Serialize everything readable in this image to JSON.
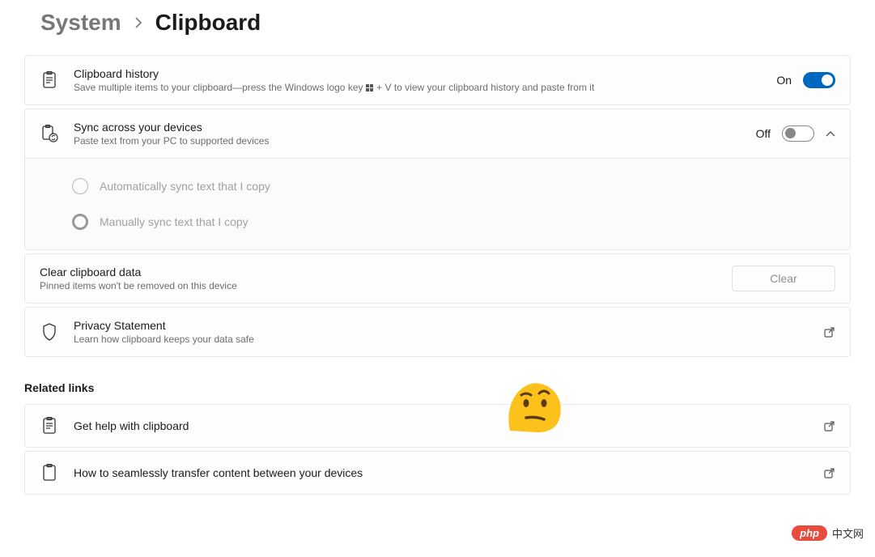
{
  "breadcrumb": {
    "parent": "System",
    "current": "Clipboard"
  },
  "cards": {
    "history": {
      "title": "Clipboard history",
      "desc_pre": "Save multiple items to your clipboard—press the Windows logo key ",
      "desc_post": " + V to view your clipboard history and paste from it",
      "state_label": "On",
      "toggle_on": true
    },
    "sync": {
      "title": "Sync across your devices",
      "desc": "Paste text from your PC to supported devices",
      "state_label": "Off",
      "toggle_on": false,
      "expanded": true,
      "options": {
        "auto": {
          "label": "Automatically sync text that I copy",
          "selected": false
        },
        "manual": {
          "label": "Manually sync text that I copy",
          "selected": true
        }
      }
    },
    "clear": {
      "title": "Clear clipboard data",
      "desc": "Pinned items won't be removed on this device",
      "button_label": "Clear"
    },
    "privacy": {
      "title": "Privacy Statement",
      "desc": "Learn how clipboard keeps your data safe"
    }
  },
  "related": {
    "heading": "Related links",
    "help": {
      "title": "Get help with clipboard"
    },
    "transfer": {
      "title": "How to seamlessly transfer content between your devices"
    }
  },
  "watermark": {
    "brand": "php",
    "site": "中文网"
  }
}
